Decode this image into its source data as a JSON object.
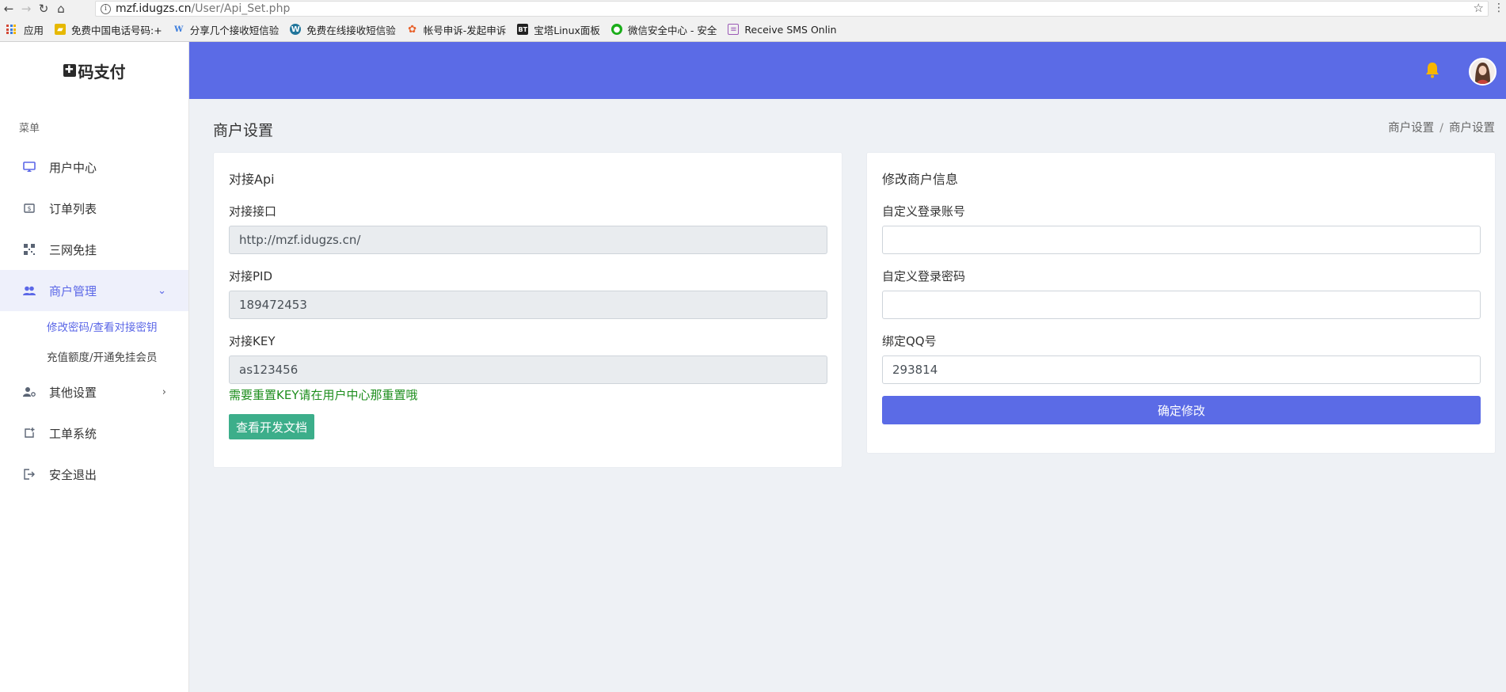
{
  "browser": {
    "url_host": "mzf.idugzs.cn",
    "url_path": "/User/Api_Set.php",
    "bookmarks": [
      {
        "label": "应用",
        "icon": "apps-grid-icon",
        "color": "#d34836"
      },
      {
        "label": "免费中国电话号码:+",
        "icon": "folder-icon",
        "color": "#e6b800"
      },
      {
        "label": "分享几个接收短信验",
        "icon": "w-icon",
        "color": "#3b7ddd"
      },
      {
        "label": "免费在线接收短信验",
        "icon": "wordpress-icon",
        "color": "#21759b"
      },
      {
        "label": "帐号申诉-发起申诉",
        "icon": "flower-icon",
        "color": "#e8622c"
      },
      {
        "label": "宝塔Linux面板",
        "icon": "bt-icon",
        "color": "#222222"
      },
      {
        "label": "微信安全中心 - 安全",
        "icon": "wechat-icon",
        "color": "#1aad19"
      },
      {
        "label": "Receive SMS Onlin",
        "icon": "sms-icon",
        "color": "#9b59b6"
      }
    ]
  },
  "brand": {
    "name": "码支付",
    "icon_glyph": "✚"
  },
  "sidebar": {
    "menu_title": "菜单",
    "items": [
      {
        "label": "用户中心",
        "icon": "monitor-icon"
      },
      {
        "label": "订单列表",
        "icon": "dollar-icon"
      },
      {
        "label": "三网免挂",
        "icon": "qrcode-icon"
      },
      {
        "label": "商户管理",
        "icon": "users-icon"
      },
      {
        "label": "其他设置",
        "icon": "user-gear-icon"
      },
      {
        "label": "工单系统",
        "icon": "ticket-icon"
      },
      {
        "label": "安全退出",
        "icon": "logout-icon"
      }
    ],
    "sub_items": [
      {
        "label": "修改密码/查看对接密钥"
      },
      {
        "label": "充值额度/开通免挂会员"
      }
    ]
  },
  "header": {
    "accent": "#5b6be6",
    "bell_color": "#f7b500"
  },
  "page": {
    "title": "商户设置",
    "breadcrumb": [
      "商户设置",
      "商户设置"
    ],
    "breadcrumb_sep": "/"
  },
  "api_card": {
    "title": "对接Api",
    "interface_label": "对接接口",
    "interface_value": "http://mzf.idugzs.cn/",
    "pid_label": "对接PID",
    "pid_value": "189472453",
    "key_label": "对接KEY",
    "key_value": "as123456",
    "hint": "需要重置KEY请在用户中心那重置哦",
    "doc_button": "查看开发文档"
  },
  "info_card": {
    "title": "修改商户信息",
    "account_label": "自定义登录账号",
    "account_value": "",
    "password_label": "自定义登录密码",
    "password_value": "",
    "qq_label": "绑定QQ号",
    "qq_value": "293814",
    "submit_button": "确定修改"
  }
}
